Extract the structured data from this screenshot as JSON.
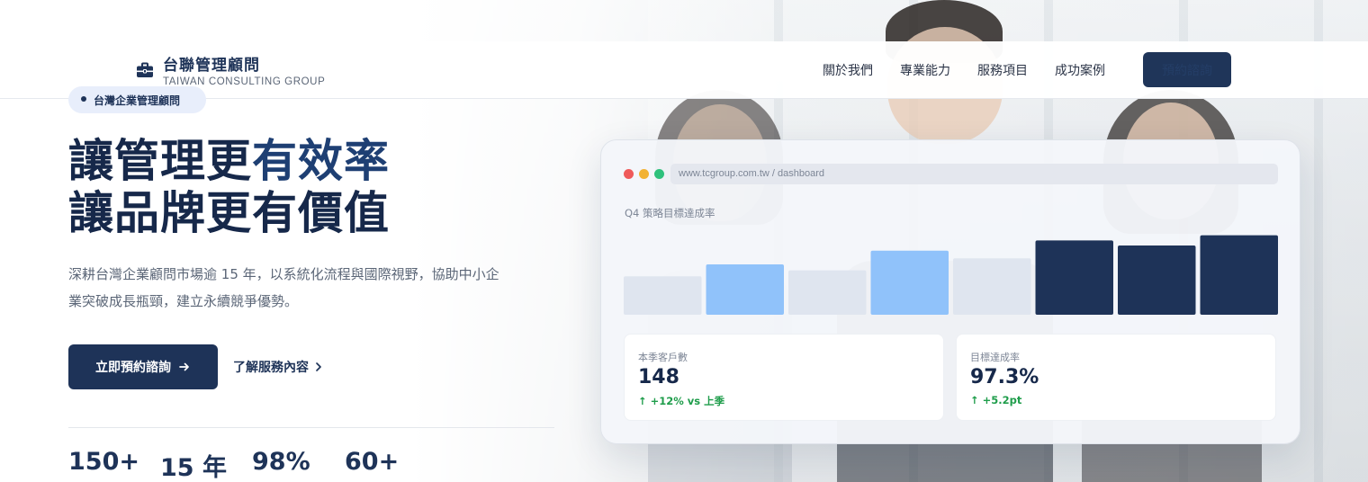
{
  "brand": {
    "title": "台聯管理顧問",
    "subtitle": "TAIWAN CONSULTING GROUP",
    "icon": "briefcase-icon"
  },
  "nav": {
    "links": [
      "關於我們",
      "專業能力",
      "服務項目",
      "成功案例"
    ],
    "cta": "預約諮詢"
  },
  "hero": {
    "tag": "台灣企業管理顧問",
    "headline_line1_a": "讓管理更",
    "headline_line1_b": "有效率",
    "headline_line2": "讓品牌更有價值",
    "description": "深耕台灣企業顧問市場逾 15 年，以系統化流程與國際視野，協助中小企業突破成長瓶頸，建立永續競爭優勢。",
    "primary_button": "立即預約諮詢",
    "primary_button_icon": "arrow-right-icon",
    "secondary_link": "了解服務內容",
    "secondary_link_icon": "chevron-right-icon",
    "stats": [
      "150+",
      "15 年",
      "98%",
      "60+"
    ]
  },
  "dashboard": {
    "url": "www.tcgroup.com.tw / dashboard",
    "window_dot_colors": [
      "#ef5a5a",
      "#f2b233",
      "#2fc17c"
    ],
    "chart_title": "Q4 策略目標達成率",
    "kpis": [
      {
        "label": "本季客戶數",
        "value": "148",
        "change": "↑ +12% vs 上季"
      },
      {
        "label": "目標達成率",
        "value": "97.3%",
        "change": "↑ +5.2pt"
      }
    ]
  },
  "chart_data": {
    "type": "bar",
    "title": "Q4 策略目標達成率",
    "values": [
      45,
      59,
      52,
      75,
      66,
      87,
      81,
      93
    ],
    "ylim": [
      0,
      100
    ],
    "colors": [
      "#dfe5ef",
      "#90c2fa",
      "#dfe5ef",
      "#90c2fa",
      "#dfe5ef",
      "#1e3358",
      "#1e3358",
      "#1e3358"
    ],
    "grid": false
  },
  "colors": {
    "primary": "#1e3358",
    "accent_light": "#90c2fa",
    "positive": "#1f9d4b"
  }
}
